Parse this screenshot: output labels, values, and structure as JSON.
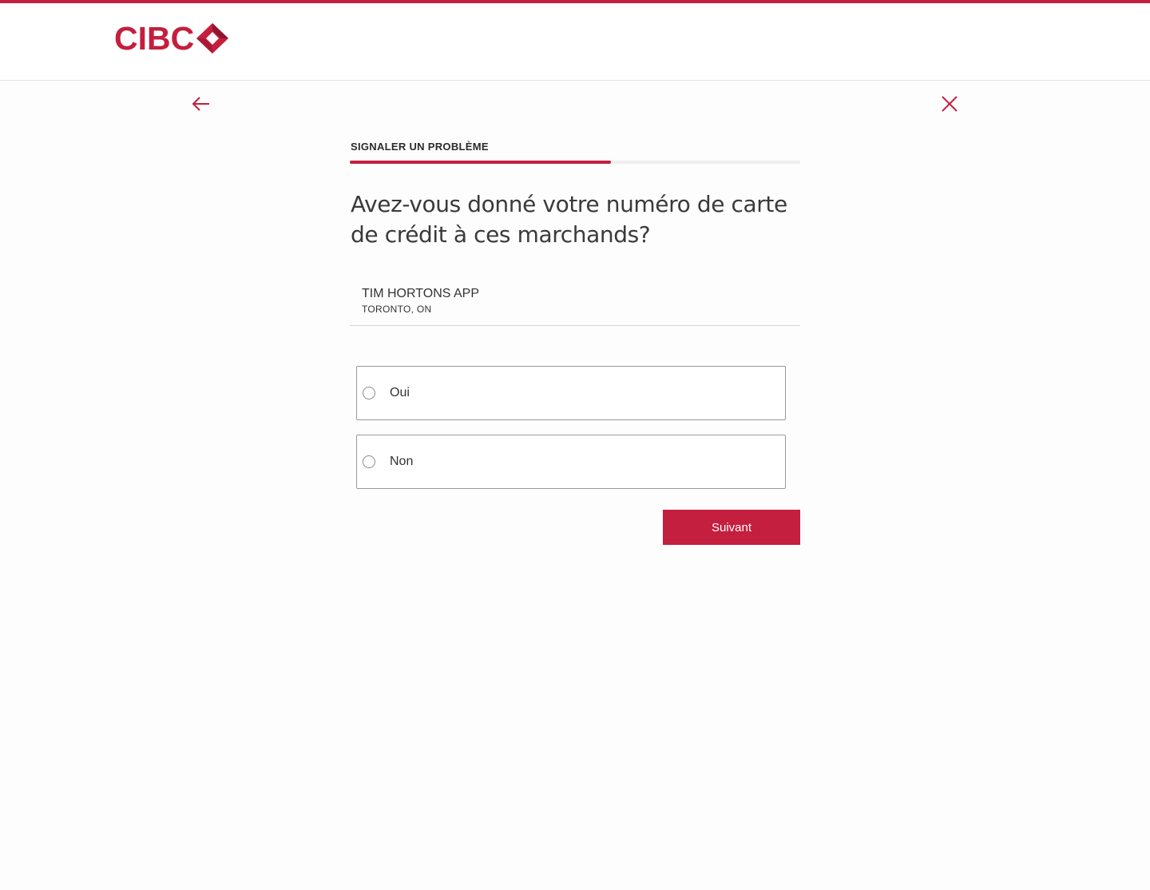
{
  "brand": {
    "name": "CIBC",
    "accent_color": "#c41f3e",
    "logo_icon": "cibc-diamond-logo"
  },
  "nav": {
    "back_icon": "arrow-left-icon",
    "close_icon": "close-x-icon"
  },
  "flow": {
    "title": "SIGNALER UN PROBLÈME",
    "progress": 0.58
  },
  "question": "Avez-vous donné votre numéro de carte de crédit à ces marchands?",
  "merchant": {
    "name": "TIM HORTONS APP",
    "location": "TORONTO, ON"
  },
  "options": [
    {
      "label": "Oui",
      "selected": false
    },
    {
      "label": "Non",
      "selected": false
    }
  ],
  "next_label": "Suivant"
}
